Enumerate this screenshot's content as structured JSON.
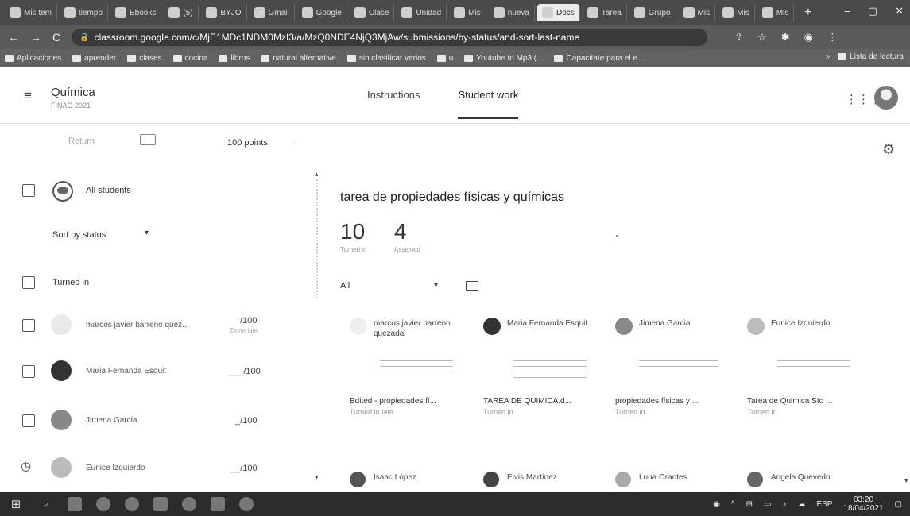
{
  "browser": {
    "tabs": [
      "Mis tem",
      "tiempo",
      "Ebooks",
      "(5)",
      "BYJO",
      "Gmail",
      "Google",
      "Clase",
      "Unidad",
      "Mis",
      "nueva",
      "Docs",
      "Tarea",
      "Grupo",
      "Mis",
      "Mis",
      "Mis"
    ],
    "active_tab_index": 11,
    "url": "classroom.google.com/c/MjE1MDc1NDM0MzI3/a/MzQ0NDE4NjQ3MjAw/submissions/by-status/and-sort-last-name",
    "bookmarks": [
      "Aplicaciones",
      "aprender",
      "clases",
      "cocina",
      "libros",
      "natural alternative",
      "sin clasificar varios",
      "u",
      "Youtube to Mp3 (...",
      "Capacitate para el e..."
    ],
    "bookmarks_more": "»",
    "reading_list": "Lista de lectura"
  },
  "classroom": {
    "class_name": "Química",
    "class_subtitle": "FINAO 2021",
    "tabs": [
      {
        "label": "Instructions"
      },
      {
        "label": "Student work"
      }
    ],
    "selected_tab": "Student work",
    "toolbar": {
      "return_label": "Return",
      "points_label": "100 points"
    },
    "left": {
      "all_students": "All students",
      "sort_label": "Sort by status",
      "group_turned_in": "Turned in",
      "students": [
        {
          "name": "marcos javier barreno quez...",
          "grade": "/100",
          "grade_sub": "Done late"
        },
        {
          "name": "Maria Fernanda Esquit",
          "grade": "___/100",
          "grade_sub": ""
        },
        {
          "name": "Jimena Garcia",
          "grade": "_/100",
          "grade_sub": ""
        },
        {
          "name": "Eunice Izquierdo",
          "grade": "__/100",
          "grade_sub": ""
        }
      ]
    },
    "assignment": {
      "title": "tarea de propiedades físicas y químicas",
      "turned_in_count": "10",
      "turned_in_label": "Turned in",
      "assigned_count": "4",
      "assigned_label": "Assigned",
      "filter_label": "All"
    },
    "cards": [
      {
        "name": "marcos javier barreno quezada",
        "file": "Edited - propiedades fí...",
        "status": "Turned in late"
      },
      {
        "name": "Maria Fernanda Esquit",
        "file": "TAREA DE QUIMICA.d...",
        "status": "Turned in"
      },
      {
        "name": "Jimena Garcia",
        "file": "propiedades físicas y ...",
        "status": "Turned in"
      },
      {
        "name": "Eunice Izquierdo",
        "file": "Tarea de Quimica Sto ...",
        "status": "Turned in"
      }
    ],
    "cards_row2": [
      {
        "name": "Isaac López"
      },
      {
        "name": "Elvis Martínez"
      },
      {
        "name": "Luna Orantes"
      },
      {
        "name": "Angela Quevedo"
      }
    ]
  },
  "taskbar": {
    "language": "ESP",
    "time": "03:20",
    "date": "18/04/2021"
  },
  "colors": {
    "browser_dark": "#4a4a4a",
    "accent": "#333333"
  }
}
